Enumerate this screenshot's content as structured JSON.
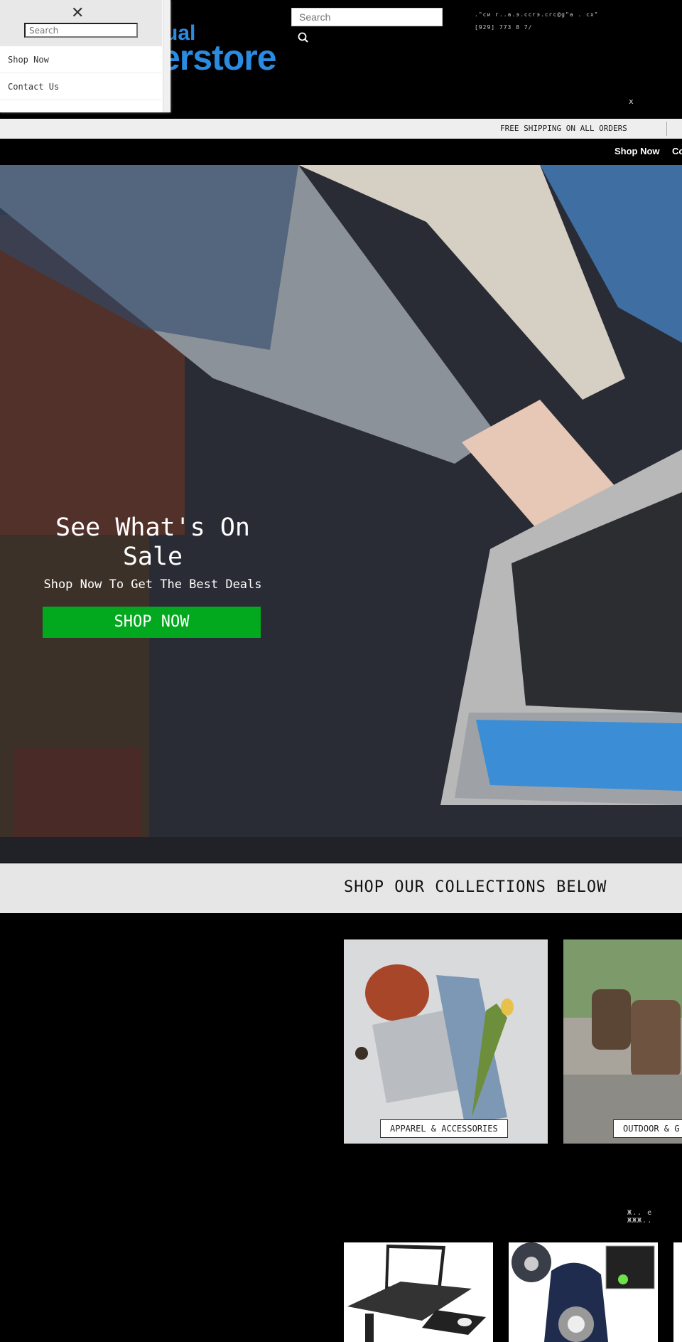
{
  "header": {
    "logo_line1": "ual",
    "logo_line2": "erstore",
    "search_placeholder": "Search",
    "contact_line1": ".\"cи г..а.э.сcгэ.сгc@g\"а . cx\"",
    "contact_line2": "[929] 773 8 7/",
    "close_label": "x"
  },
  "drawer": {
    "close_label": "✕",
    "search_placeholder": "Search",
    "items": [
      {
        "label": "Shop Now"
      },
      {
        "label": "Contact Us"
      }
    ]
  },
  "announcement": {
    "text": "FREE SHIPPING ON ALL ORDERS"
  },
  "nav": {
    "items": [
      {
        "label": "Shop Now"
      },
      {
        "label": "Co"
      }
    ]
  },
  "hero": {
    "title": "See What's On Sale",
    "subtitle": "Shop Now To Get The Best Deals",
    "button_label": "SHOP NOW",
    "button_color": "#02a81e"
  },
  "collections": {
    "title": "SHOP OUR COLLECTIONS BELOW",
    "items": [
      {
        "label": "APPAREL & ACCESSORIES"
      },
      {
        "label": "OUTDOOR & G"
      }
    ]
  },
  "products": {
    "heading": "Ж.. е ЖЖЖ.."
  },
  "colors": {
    "brand": "#2a8be0",
    "accent": "#02a81e"
  }
}
